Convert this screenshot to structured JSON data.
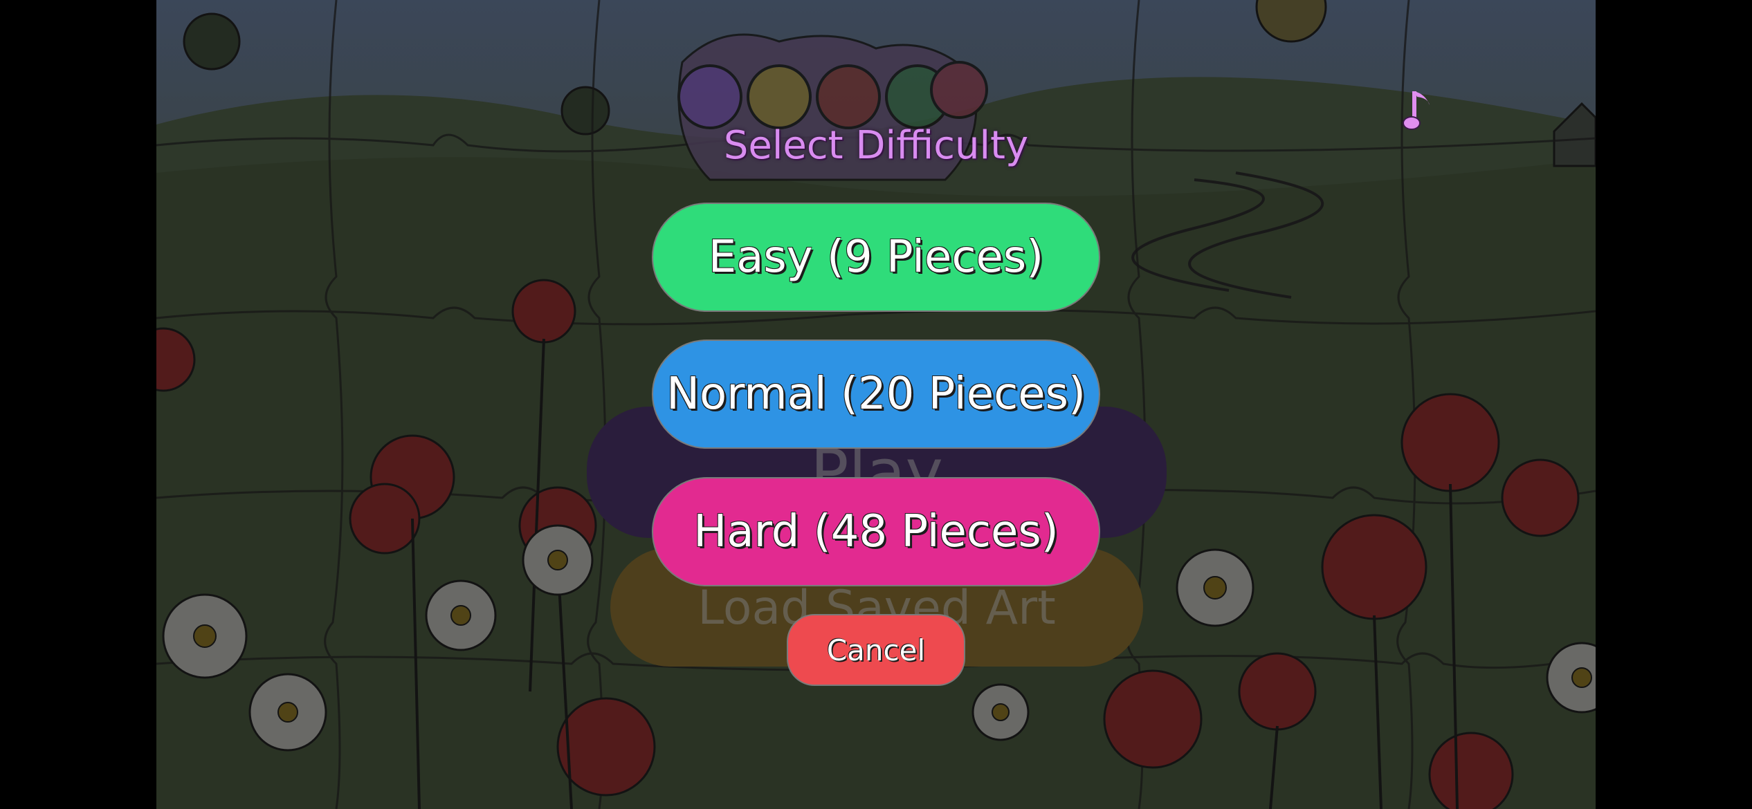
{
  "dialog": {
    "title": "Select Difficulty",
    "options": [
      {
        "label": "Easy (9 Pieces)",
        "color": "#2fdc7a"
      },
      {
        "label": "Normal (20 Pieces)",
        "color": "#2e93e4"
      },
      {
        "label": "Hard (48 Pieces)",
        "color": "#e22a90"
      }
    ],
    "cancel_label": "Cancel",
    "cancel_color": "#ee4a4f"
  },
  "background_menu": {
    "play_label": "Play",
    "load_label": "Load Saved Art"
  },
  "icons": {
    "music": "music-note-icon"
  },
  "colors": {
    "title": "#d98cf0"
  }
}
